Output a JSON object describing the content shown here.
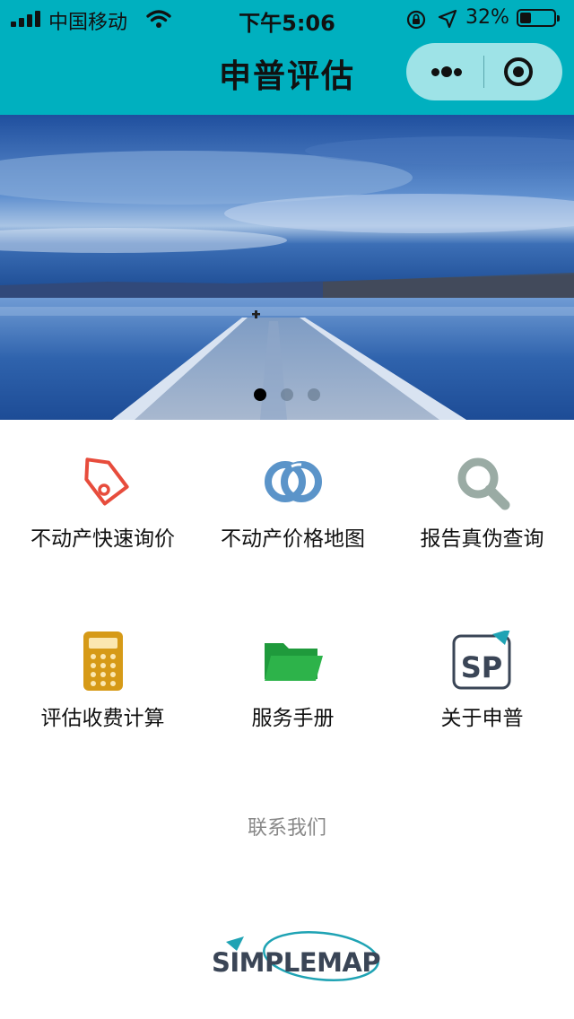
{
  "status_bar": {
    "carrier": "中国移动",
    "time": "下午5:06",
    "battery_percent": "32%",
    "battery_level": 0.32
  },
  "header": {
    "title": "申普评估",
    "more_icon": "more-dots-icon",
    "close_icon": "target-icon"
  },
  "banner": {
    "icon": "lake-pier-photo",
    "slide_count": 3,
    "active_slide": 0
  },
  "menu": [
    {
      "label": "不动产快速询价",
      "icon": "price-tag-icon",
      "color": "#e74c3c"
    },
    {
      "label": "不动产价格地图",
      "icon": "linked-rings-icon",
      "color": "#5b94c9"
    },
    {
      "label": "报告真伪查询",
      "icon": "search-icon",
      "color": "#9aaba4"
    },
    {
      "label": "评估收费计算",
      "icon": "calculator-icon",
      "color": "#d69a17"
    },
    {
      "label": "服务手册",
      "icon": "folder-icon",
      "color": "#2db34a"
    },
    {
      "label": "关于申普",
      "icon": "sp-logo-icon",
      "color": "#3a4556"
    }
  ],
  "contact_label": "联系我们",
  "brand": {
    "logo_text": "SIMPLEMAP",
    "accent": "#1fa3b4"
  }
}
